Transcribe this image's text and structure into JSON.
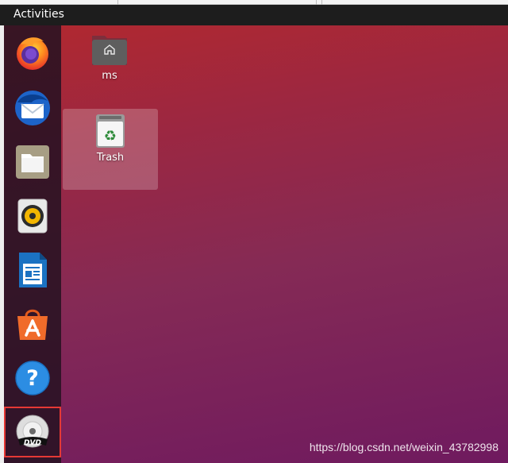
{
  "topbar": {
    "activities_label": "Activities"
  },
  "dock": {
    "items": [
      {
        "name": "firefox",
        "icon": "firefox-icon"
      },
      {
        "name": "thunderbird",
        "icon": "thunderbird-mail-icon"
      },
      {
        "name": "files",
        "icon": "files-folder-icon"
      },
      {
        "name": "rhythmbox",
        "icon": "rhythmbox-speaker-icon"
      },
      {
        "name": "libreoffice-writer",
        "icon": "writer-document-icon"
      },
      {
        "name": "ubuntu-software",
        "icon": "software-bag-icon"
      },
      {
        "name": "help",
        "icon": "help-icon"
      },
      {
        "name": "dvd",
        "icon": "dvd-disc-icon",
        "selected": true
      }
    ]
  },
  "desktop": {
    "icons": [
      {
        "label": "ms",
        "icon": "home-folder-icon"
      },
      {
        "label": "Trash",
        "icon": "trash-icon"
      }
    ]
  },
  "watermark": "https://blog.csdn.net/weixin_43782998",
  "colors": {
    "topbar": "#1d1d1d",
    "desktop_top": "#b1282f",
    "desktop_bottom": "#6f1a5f",
    "selection_border": "#e53935"
  }
}
